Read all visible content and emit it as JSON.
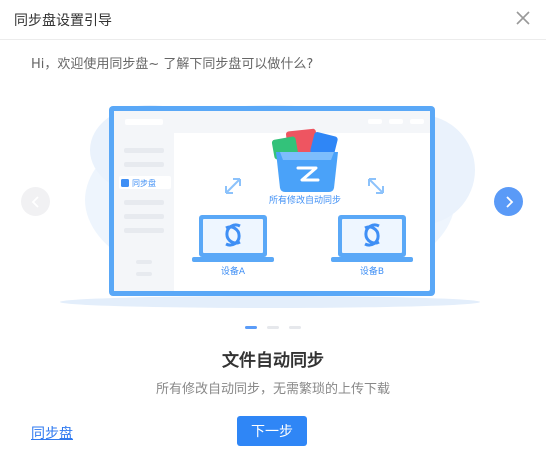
{
  "dialog": {
    "title": "同步盘设置引导",
    "intro": "Hi，欢迎使用同步盘~ 了解下同步盘可以做什么?"
  },
  "illustration": {
    "sidebar_label": "同步盘",
    "center_caption": "所有修改自动同步",
    "device_a": "设备A",
    "device_b": "设备B"
  },
  "carousel": {
    "current_page": 1,
    "total_pages": 3
  },
  "slide": {
    "heading": "文件自动同步",
    "subheading": "所有修改自动同步，无需繁琐的上传下载"
  },
  "footer": {
    "link_label": "同步盘",
    "next_label": "下一步"
  },
  "colors": {
    "accent": "#2f86f6",
    "illustration_blue": "#5aa8f7",
    "link": "#2f7af0"
  },
  "icons": [
    "close-icon",
    "chevron-left-icon",
    "chevron-right-icon",
    "folder-icon",
    "sync-icon"
  ]
}
